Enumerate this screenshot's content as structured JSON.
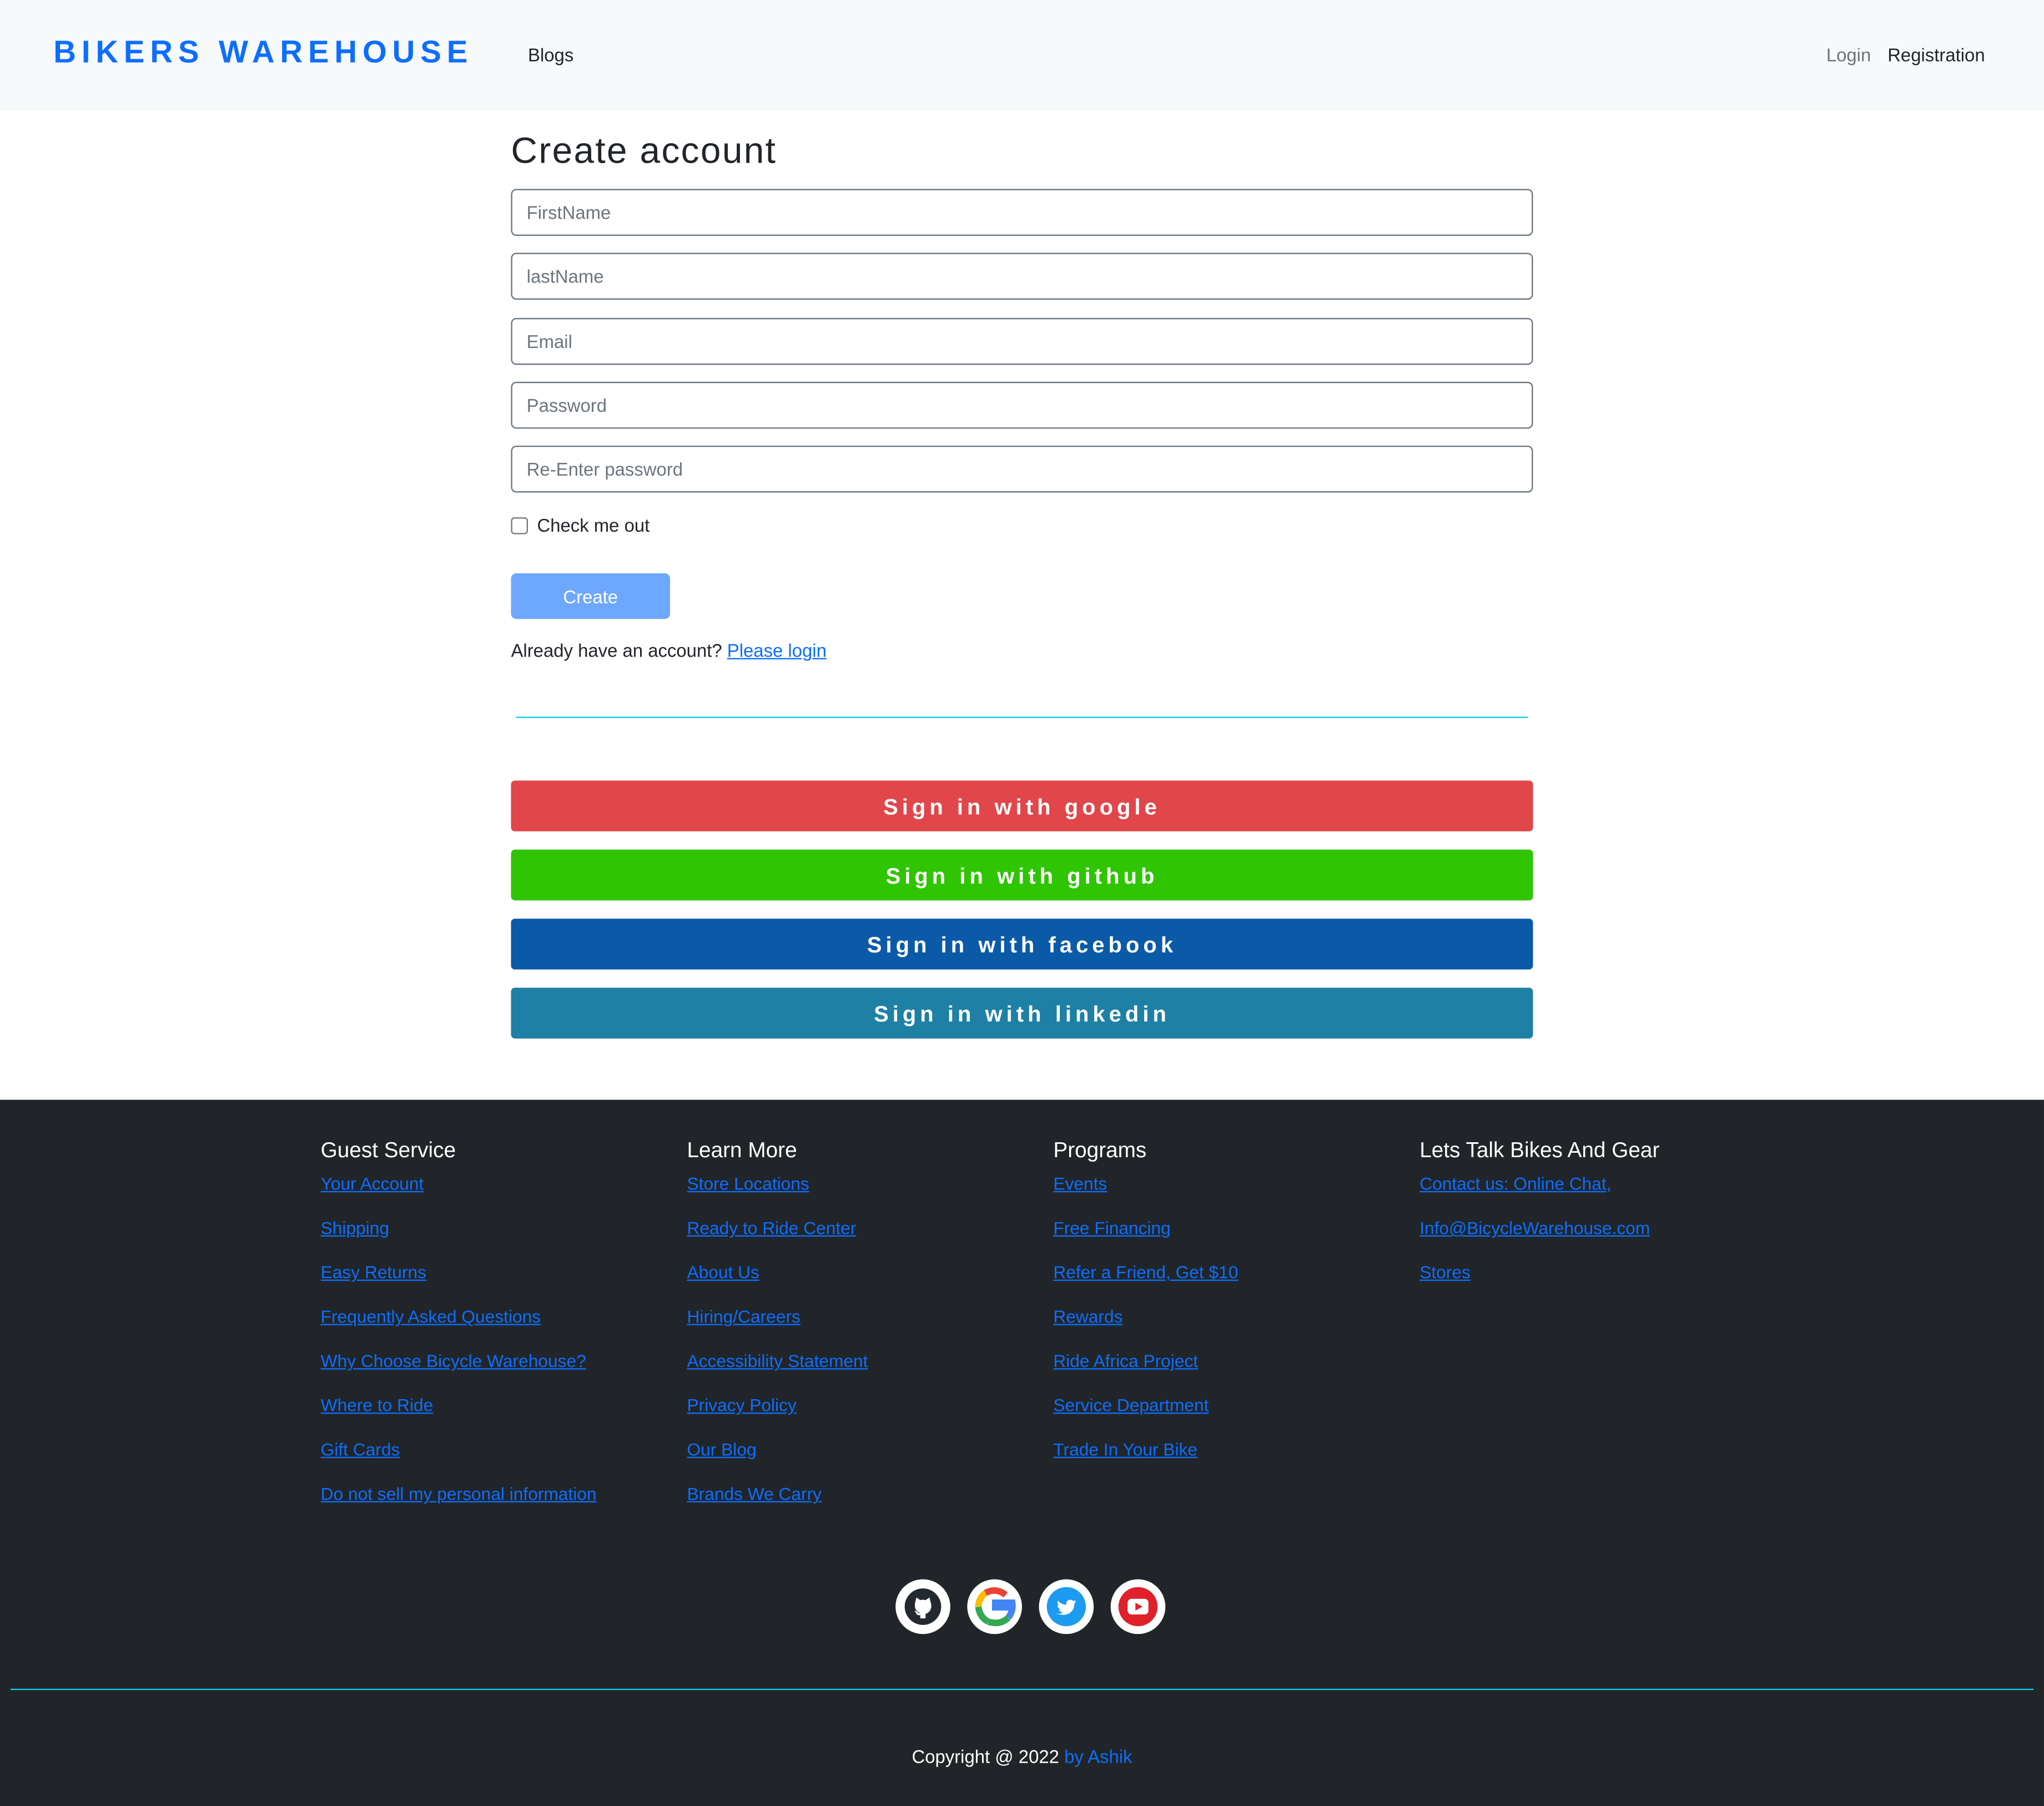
{
  "navbar": {
    "brand": "BIKERS WAREHOUSE",
    "blogs": "Blogs",
    "login": "Login",
    "registration": "Registration"
  },
  "form": {
    "title": "Create account",
    "first_name_placeholder": "FirstName",
    "last_name_placeholder": "lastName",
    "email_placeholder": "Email",
    "password_placeholder": "Password",
    "reenter_placeholder": "Re-Enter password",
    "checkbox_label": "Check me out",
    "create_label": "Create",
    "already_text": "Already have an account?",
    "login_link": "Please login"
  },
  "social_signin": {
    "google": "Sign in with google",
    "github": "Sign in with github",
    "facebook": "Sign in with facebook",
    "linkedin": "Sign in with linkedin"
  },
  "footer": {
    "columns": [
      {
        "heading": "Guest Service",
        "links": [
          "Your Account",
          "Shipping",
          "Easy Returns",
          "Frequently Asked Questions",
          "Why Choose Bicycle Warehouse?",
          "Where to Ride",
          "Gift Cards",
          "Do not sell my personal information"
        ]
      },
      {
        "heading": "Learn More",
        "links": [
          "Store Locations",
          "Ready to Ride Center",
          "About Us",
          "Hiring/Careers",
          "Accessibility Statement",
          "Privacy Policy",
          "Our Blog",
          "Brands We Carry"
        ]
      },
      {
        "heading": "Programs",
        "links": [
          "Events",
          "Free Financing",
          "Refer a Friend, Get $10",
          "Rewards",
          "Ride Africa Project",
          "Service Department",
          "Trade In Your Bike"
        ]
      },
      {
        "heading": "Lets Talk Bikes And Gear",
        "links": [
          "Contact us: Online Chat,",
          "Info@BicycleWarehouse.com",
          "Stores"
        ]
      }
    ],
    "social_icons": [
      "github-icon",
      "google-icon",
      "twitter-icon",
      "youtube-icon"
    ],
    "copyright": "Copyright @ 2022",
    "author": "by Ashik"
  },
  "colors": {
    "brand": "#0d6efd",
    "google": "#e0464a",
    "github": "#2fc502",
    "facebook": "#0b5aa8",
    "linkedin": "#1e80a5",
    "footer_bg": "#212529",
    "divider": "#0dcaf0"
  }
}
